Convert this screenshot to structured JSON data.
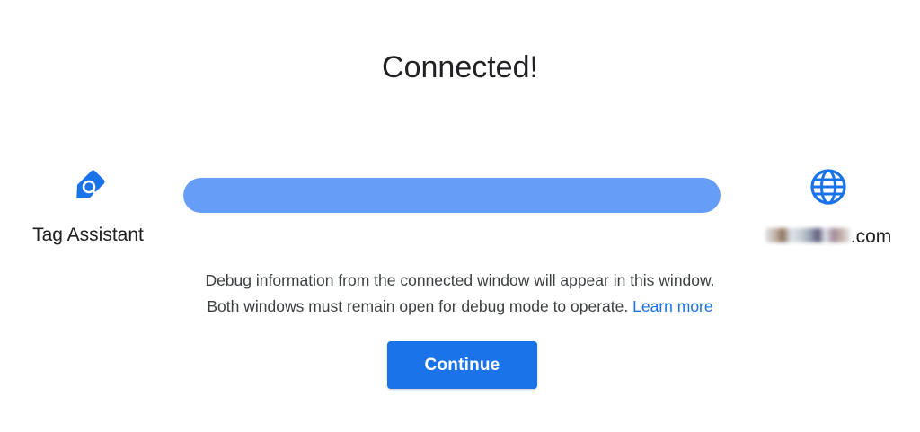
{
  "dialog": {
    "title": "Connected!",
    "left_endpoint": {
      "label": "Tag Assistant",
      "icon": "tag-assistant-icon"
    },
    "right_endpoint": {
      "label_suffix": ".com",
      "icon": "globe-icon"
    },
    "progress": {
      "value_percent": 100
    },
    "info_line_1": "Debug information from the connected window will appear in this window.",
    "info_line_2": "Both windows must remain open for debug mode to operate.",
    "learn_more": "Learn more",
    "continue_label": "Continue"
  },
  "colors": {
    "accent": "#1a73e8",
    "progress": "#669df6",
    "text": "#202124"
  }
}
